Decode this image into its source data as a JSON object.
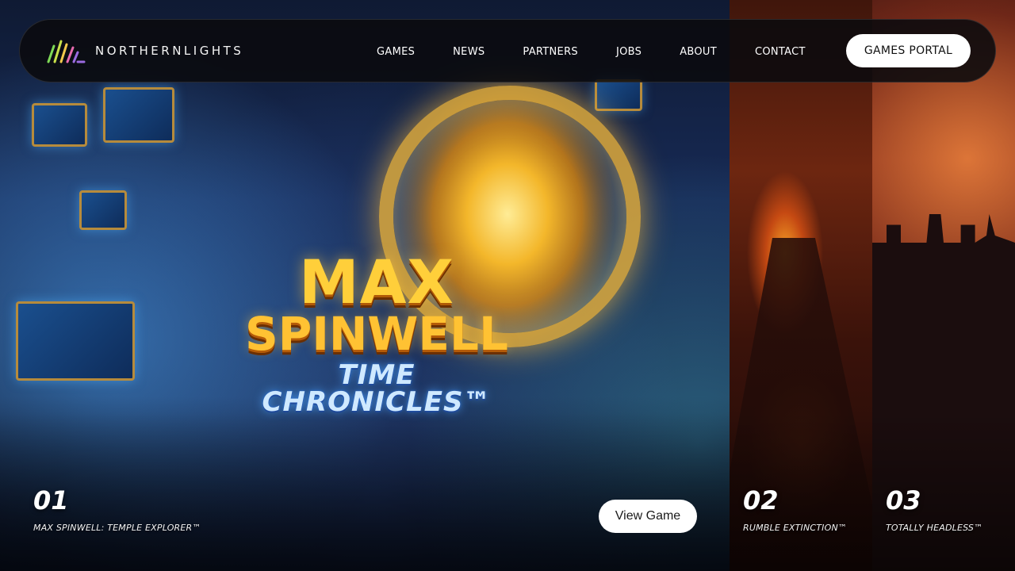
{
  "brand": {
    "name": "NORTHERNLIGHTS",
    "logo_colors": [
      "#7ed957",
      "#c8e04a",
      "#f2c94c",
      "#e86bb0",
      "#9b6be0"
    ]
  },
  "nav": {
    "links": [
      "GAMES",
      "NEWS",
      "PARTNERS",
      "JOBS",
      "ABOUT",
      "CONTACT"
    ],
    "cta_label": "GAMES PORTAL"
  },
  "hero": {
    "logo_lines": [
      "MAX",
      "SPINWELL",
      "TIME CHRONICLES™"
    ],
    "view_button_label": "View Game"
  },
  "slides": [
    {
      "number": "01",
      "title": "MAX SPINWELL: TEMPLE EXPLORER™"
    },
    {
      "number": "02",
      "title": "RUMBLE EXTINCTION™"
    },
    {
      "number": "03",
      "title": "TOTALLY HEADLESS™"
    }
  ]
}
